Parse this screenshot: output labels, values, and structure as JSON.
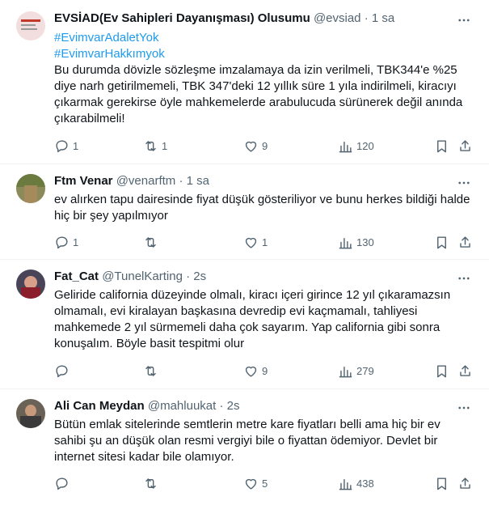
{
  "tweets": [
    {
      "name": "EVSİAD(Ev Sahipleri Dayanışması) Olusumu",
      "handle": "@evsiad",
      "dot": "·",
      "time": "1 sa",
      "hashtags": [
        "#EvimvarAdaletYok",
        "#EvimvarHakkımyok"
      ],
      "text": "Bu durumda dövizle sözleşme imzalamaya da izin verilmeli, TBK344'e %25 diye narh getirilmemeli, TBK 347'deki 12 yıllık süre 1 yıla indirilmeli, kiracıyı çıkarmak gerekirse öyle mahkemelerde arabulucuda sürünerek değil anında çıkarabilmeli!",
      "replies": "1",
      "retweets": "1",
      "likes": "9",
      "views": "120",
      "avatar_color": "#f2dede"
    },
    {
      "name": "Ftm Venar",
      "handle": "@venarftm",
      "dot": "·",
      "time": "1 sa",
      "hashtags": [],
      "text": "ev alırken tapu dairesinde fiyat düşük gösteriliyor ve bunu herkes bildiği halde hiç bir şey yapılmıyor",
      "replies": "1",
      "retweets": "",
      "likes": "1",
      "views": "130",
      "avatar_color": "#8a8a5a"
    },
    {
      "name": "Fat_Cat",
      "handle": "@TunelKarting",
      "dot": "·",
      "time": "2s",
      "hashtags": [],
      "text": "Geliride california düzeyinde olmalı, kiracı içeri girince 12 yıl çıkaramazsın olmamalı, evi kiralayan başkasına devredip evi kaçmamalı, tahliyesi mahkemede 2 yıl sürmemeli daha çok sayarım. Yap california gibi sonra konuşalım. Böyle basit tespitmi olur",
      "replies": "",
      "retweets": "",
      "likes": "9",
      "views": "279",
      "avatar_color": "#4a4458"
    },
    {
      "name": "Ali Can Meydan",
      "handle": "@mahluukat",
      "dot": "·",
      "time": "2s",
      "hashtags": [],
      "text": "Bütün emlak sitelerinde semtlerin metre kare fiyatları belli ama hiç bir ev sahibi şu an düşük olan resmi vergiyi bile o fiyattan ödemiyor. Devlet bir internet sitesi kadar bile olamıyor.",
      "replies": "",
      "retweets": "",
      "likes": "5",
      "views": "438",
      "avatar_color": "#6b6257"
    }
  ]
}
